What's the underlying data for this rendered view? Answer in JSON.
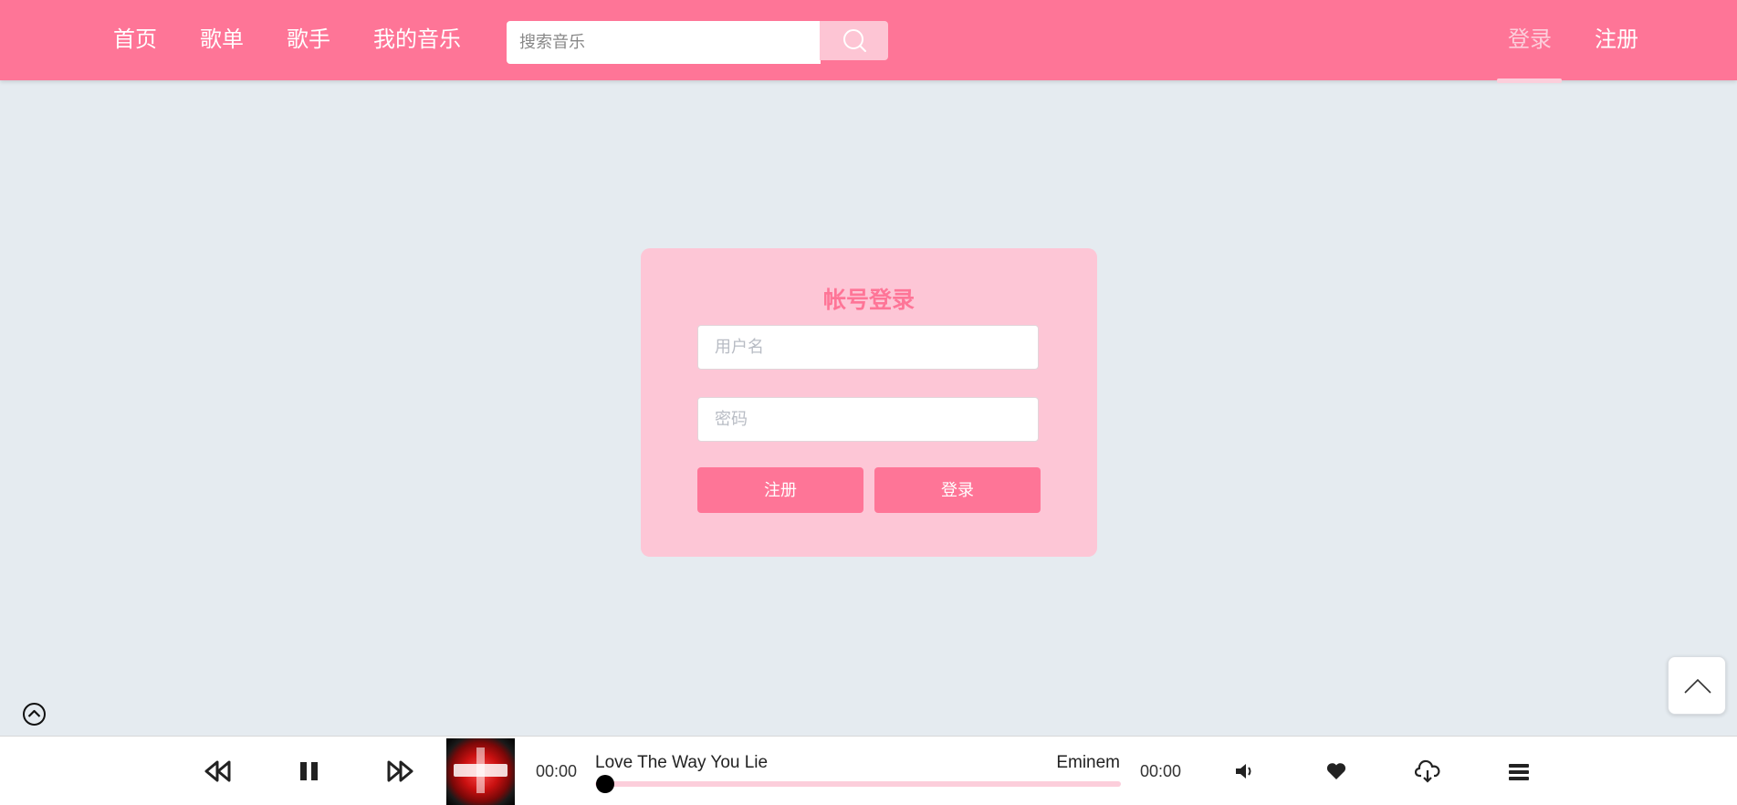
{
  "header": {
    "nav": [
      "首页",
      "歌单",
      "歌手",
      "我的音乐"
    ],
    "search": {
      "placeholder": "搜索音乐",
      "value": ""
    },
    "login_label": "登录",
    "register_label": "注册"
  },
  "login_card": {
    "title": "帐号登录",
    "username_placeholder": "用户名",
    "password_placeholder": "密码",
    "register_button": "注册",
    "login_button": "登录"
  },
  "player": {
    "current_time": "00:00",
    "duration": "00:00",
    "song_title": "Love The Way You Lie",
    "artist": "Eminem",
    "progress": 0,
    "controls": [
      "rewind-icon",
      "pause-icon",
      "fast-forward-icon",
      "volume-icon",
      "heart-icon",
      "cloud-download-icon",
      "playlist-menu-icon"
    ]
  },
  "colors": {
    "brand": "#fe7597",
    "brand_light": "#fdc6d6",
    "background": "#e5ebf0",
    "login_active": "#fccedb"
  }
}
